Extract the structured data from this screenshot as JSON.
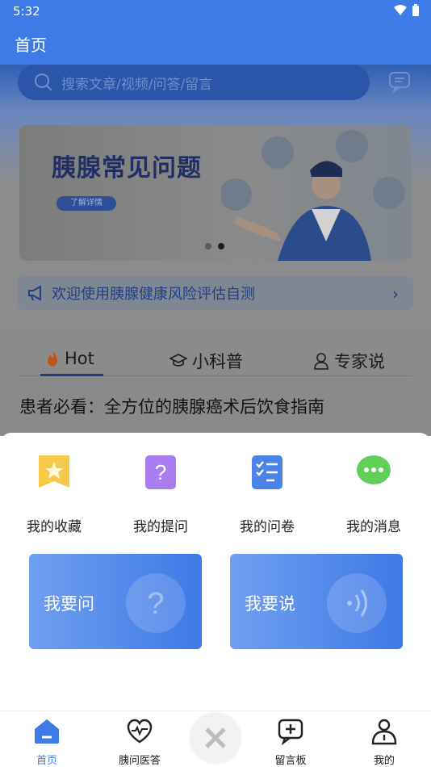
{
  "status": {
    "time": "5:32"
  },
  "app": {
    "title": "首页"
  },
  "search": {
    "placeholder": "搜索文章/视频/问答/留言"
  },
  "banner": {
    "title": "胰腺常见问题",
    "button": "了解详情"
  },
  "notice": {
    "text": "欢迎使用胰腺健康风险评估自测"
  },
  "tabs": [
    {
      "label": "Hot"
    },
    {
      "label": "小科普"
    },
    {
      "label": "专家说"
    }
  ],
  "article": {
    "headline": "患者必看：全方位的胰腺癌术后饮食指南"
  },
  "quick_actions": [
    {
      "label": "我的收藏",
      "icon": "bookmark-star-icon"
    },
    {
      "label": "我的提问",
      "icon": "question-note-icon"
    },
    {
      "label": "我的问卷",
      "icon": "checklist-icon"
    },
    {
      "label": "我的消息",
      "icon": "chat-bubble-icon"
    }
  ],
  "big_actions": [
    {
      "label": "我要问",
      "icon": "question-icon"
    },
    {
      "label": "我要说",
      "icon": "voice-icon"
    }
  ],
  "bottom_nav": [
    {
      "label": "首页",
      "icon": "home-icon"
    },
    {
      "label": "胰问医答",
      "icon": "heart-pulse-icon"
    },
    {
      "label": "留言板",
      "icon": "add-message-icon"
    },
    {
      "label": "我的",
      "icon": "user-icon"
    }
  ],
  "colors": {
    "brand": "#3f7be6",
    "active": "#3f7be6"
  }
}
